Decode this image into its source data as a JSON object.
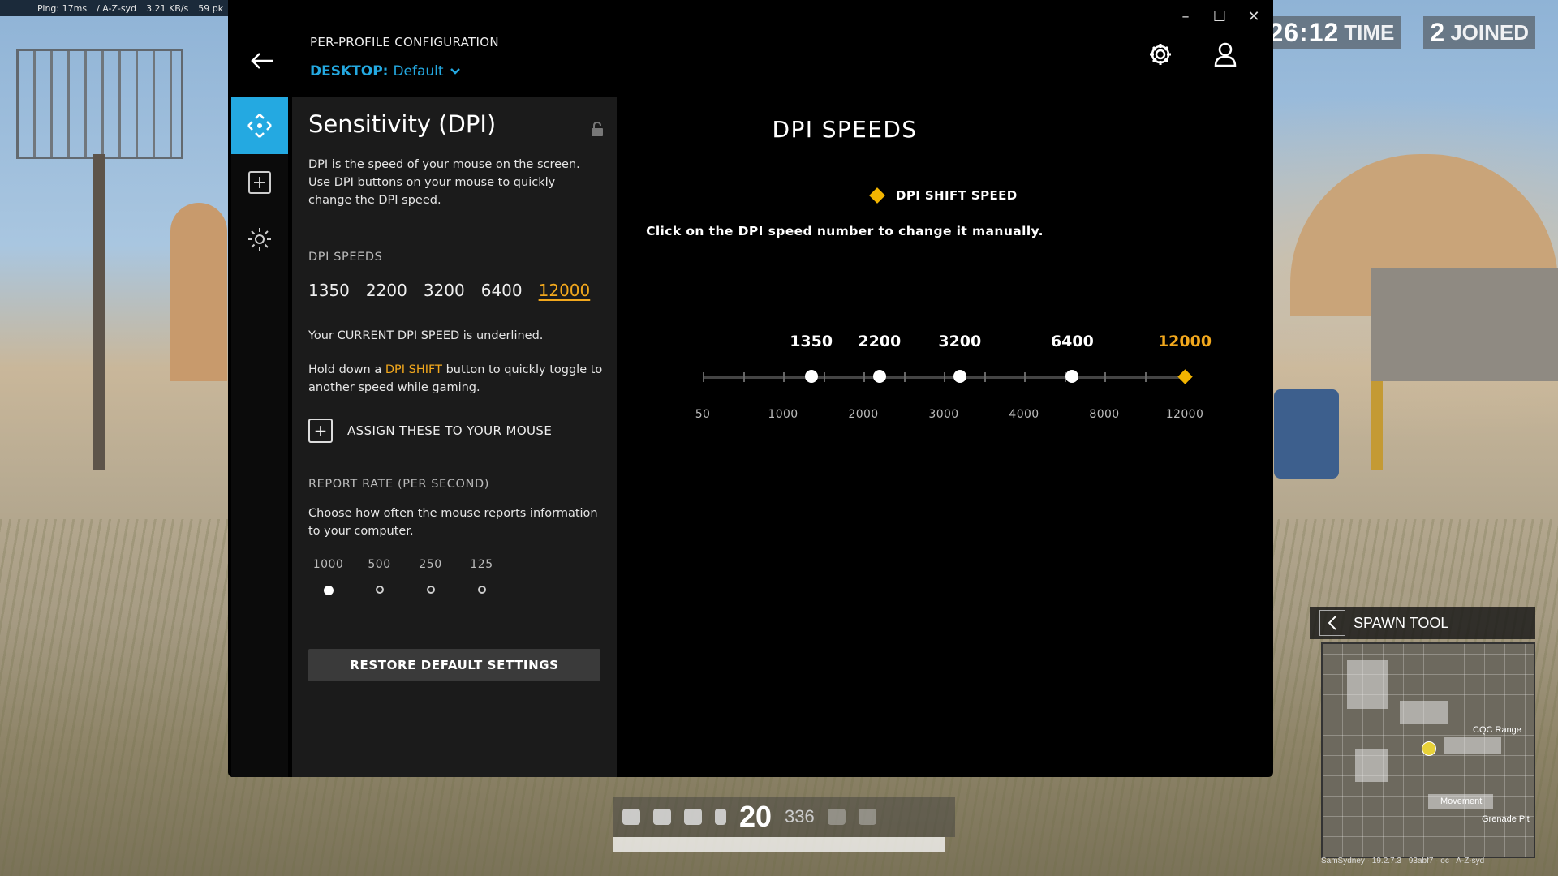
{
  "game": {
    "status": [
      "Ping: 17ms",
      "/ A-Z-syd",
      "3.21 KB/s",
      "59 pk"
    ],
    "time_value": "26:12",
    "time_label": "TIME",
    "joined_value": "2",
    "joined_label": "JOINED",
    "spawn_tool": "SPAWN TOOL",
    "map_labels": [
      "CQC Range",
      "Movement",
      "Grenade Pit"
    ],
    "map_footer": "SamSydney · 19.2.7.3 · 93abf7 · oc · A-Z-syd",
    "ammo": "20",
    "reserve": "336"
  },
  "window": {
    "controls": [
      "–",
      "☐",
      "✕"
    ]
  },
  "header": {
    "title": "PER-PROFILE CONFIGURATION",
    "profile_key": "DESKTOP:",
    "profile_value": "Default"
  },
  "panel": {
    "title": "Sensitivity (DPI)",
    "description": "DPI is the speed of your mouse on the screen. Use DPI buttons on your mouse to quickly change the DPI speed.",
    "dpi_speeds_label": "DPI SPEEDS",
    "dpi_speeds": [
      "1350",
      "2200",
      "3200",
      "6400",
      "12000"
    ],
    "current_note": "Your CURRENT DPI SPEED is underlined.",
    "shift_pre": "Hold down a ",
    "shift_word": "DPI SHIFT",
    "shift_post": " button to quickly toggle to another speed while gaming.",
    "assign_label": "ASSIGN THESE TO YOUR MOUSE",
    "report_rate_label": "REPORT RATE (PER SECOND)",
    "report_rate_desc": "Choose how often the mouse reports information to your computer.",
    "report_rates": [
      "1000",
      "500",
      "250",
      "125"
    ],
    "report_rate_selected": "1000",
    "restore_label": "RESTORE DEFAULT SETTINGS"
  },
  "main": {
    "title": "DPI SPEEDS",
    "shift_label": "DPI SHIFT SPEED",
    "hint": "Click on the DPI speed number to change it manually.",
    "speed_labels": [
      "1350",
      "2200",
      "3200",
      "6400",
      "12000"
    ],
    "current_speed": "12000",
    "shift_speed": "12000",
    "axis_labels": [
      "50",
      "1000",
      "2000",
      "3000",
      "4000",
      "8000",
      "12000"
    ]
  },
  "colors": {
    "accent_blue": "#24a9e1",
    "accent_orange": "#f2a81d",
    "shift_yellow": "#f2b400"
  }
}
